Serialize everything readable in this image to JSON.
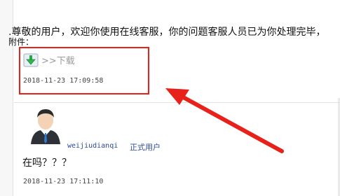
{
  "message1": {
    "text": ".尊敬的用户，欢迎你使用在线客服，你的问题客服人员已为你处理完毕，",
    "attachment_label": "附件：",
    "download_link": ">>下载",
    "timestamp": "2018-11-23 17:09:58"
  },
  "message2": {
    "username": "weijiudianqi",
    "user_badge": "正式用户",
    "text": "在吗？？？",
    "timestamp": "2018-11-23 17:11:10"
  },
  "annotation": {
    "highlight_color": "#e8221b",
    "arrow_color": "#e8221b"
  },
  "icons": {
    "download": "download-arrow-icon",
    "avatar": "user-avatar-icon"
  }
}
